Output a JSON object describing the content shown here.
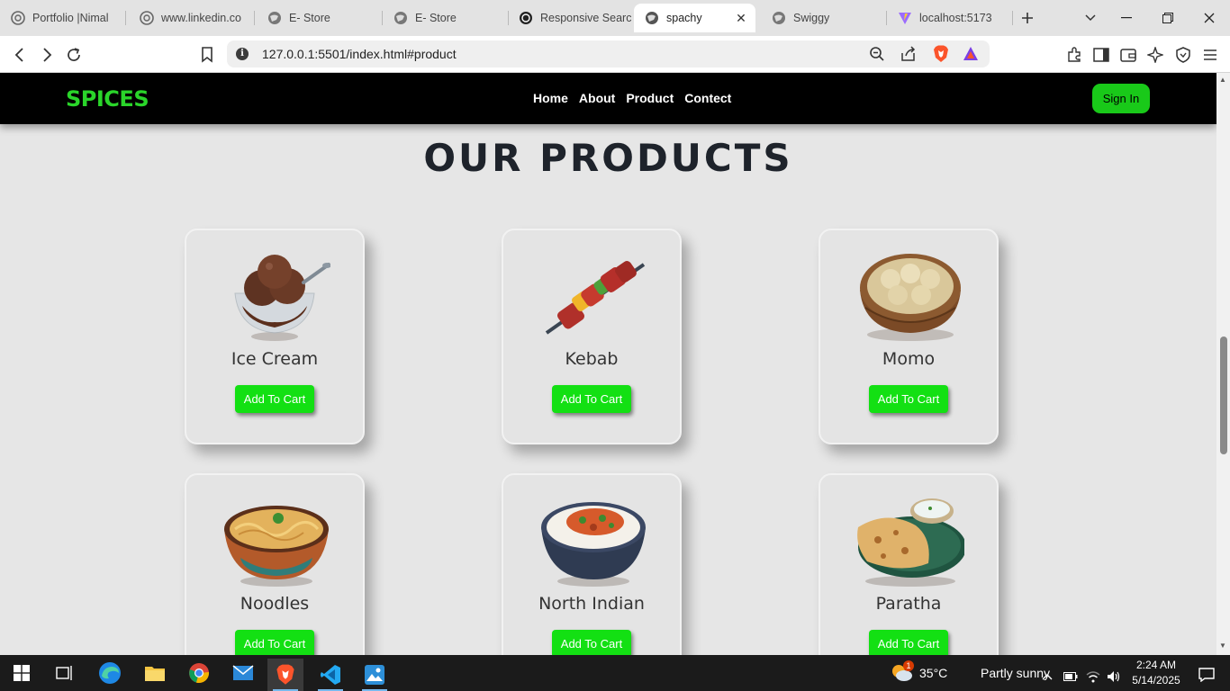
{
  "browser": {
    "tabs": [
      {
        "title": "Portfolio |Nimal",
        "icon": "globe-icon"
      },
      {
        "title": "www.linkedin.co",
        "icon": "globe-icon"
      },
      {
        "title": "E- Store",
        "icon": "globe-icon"
      },
      {
        "title": "E- Store",
        "icon": "globe-icon"
      },
      {
        "title": "Responsive Searc",
        "icon": "openai-icon"
      },
      {
        "title": "spachy",
        "icon": "globe-icon",
        "active": true
      },
      {
        "title": "Swiggy",
        "icon": "globe-icon"
      },
      {
        "title": "localhost:5173",
        "icon": "vite-icon"
      }
    ],
    "url": "127.0.0.1:5501/index.html#product"
  },
  "site": {
    "brand": "SPICES",
    "nav": [
      "Home",
      "About",
      "Product",
      "Contect"
    ],
    "signin": "Sign In",
    "section_title": "OUR PRODUCTS",
    "products": [
      {
        "name": "Ice Cream",
        "button": "Add To Cart",
        "image": "ice-cream-image"
      },
      {
        "name": "Kebab",
        "button": "Add To Cart",
        "image": "kebab-image"
      },
      {
        "name": "Momo",
        "button": "Add To Cart",
        "image": "momo-image"
      },
      {
        "name": "Noodles",
        "button": "Add To Cart",
        "image": "noodles-image"
      },
      {
        "name": "North Indian",
        "button": "Add To Cart",
        "image": "north-indian-image"
      },
      {
        "name": "Paratha",
        "button": "Add To Cart",
        "image": "paratha-image"
      }
    ]
  },
  "taskbar": {
    "weather": {
      "temp": "35°C",
      "text": "Partly sunny",
      "badge": "1"
    },
    "time": "2:24 AM",
    "date": "5/14/2025"
  },
  "colors": {
    "brand": "#2ad52a",
    "button": "#13e013",
    "signin": "#19c919",
    "nav_bg": "#000000"
  }
}
